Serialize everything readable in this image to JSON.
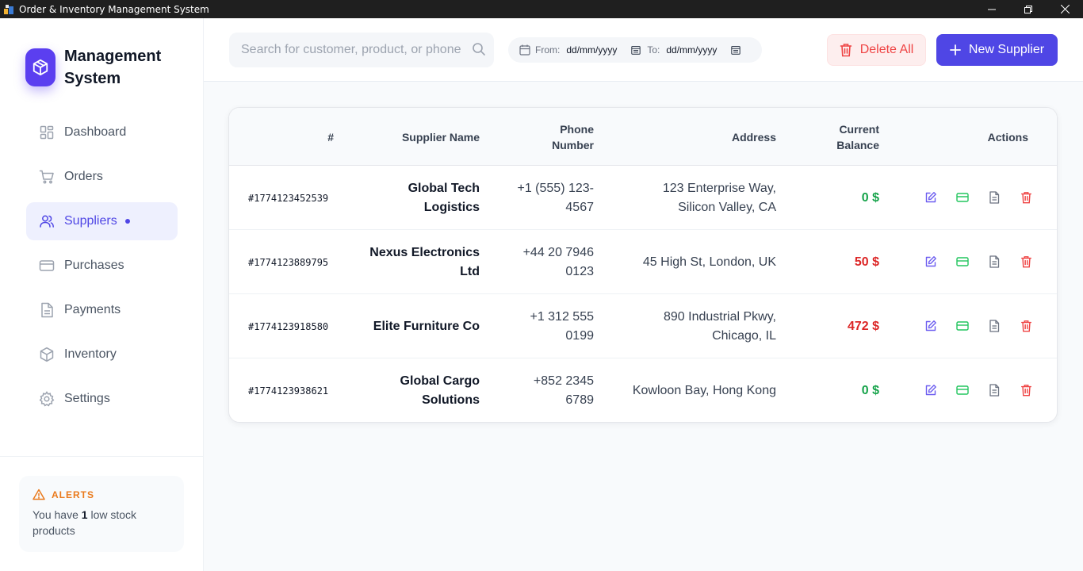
{
  "window": {
    "title": "Order & Inventory Management System"
  },
  "sidebar": {
    "brand": "Management System",
    "items": [
      {
        "label": "Dashboard",
        "icon": "dashboard-icon",
        "active": false
      },
      {
        "label": "Orders",
        "icon": "cart-icon",
        "active": false
      },
      {
        "label": "Suppliers",
        "icon": "users-icon",
        "active": true
      },
      {
        "label": "Purchases",
        "icon": "card-icon",
        "active": false
      },
      {
        "label": "Payments",
        "icon": "document-icon",
        "active": false
      },
      {
        "label": "Inventory",
        "icon": "box-icon",
        "active": false
      },
      {
        "label": "Settings",
        "icon": "gear-icon",
        "active": false
      }
    ],
    "alerts": {
      "title": "ALERTS",
      "text_before": "You have ",
      "count": "1",
      "text_after": " low stock products"
    }
  },
  "topbar": {
    "search_placeholder": "Search for customer, product, or phone",
    "from_label": "From:",
    "from_value": "dd/mm/yyyy",
    "to_label": "To:",
    "to_value": "dd/mm/yyyy",
    "delete_all_label": "Delete All",
    "new_supplier_label": "New Supplier"
  },
  "table": {
    "headers": {
      "id": "#",
      "name": "Supplier Name",
      "phone": "Phone Number",
      "address": "Address",
      "balance": "Current Balance",
      "actions": "Actions"
    },
    "rows": [
      {
        "id": "#1774123452539",
        "name": "Global Tech Logistics",
        "phone": "+1 (555) 123-4567",
        "address": "123 Enterprise Way, Silicon Valley, CA",
        "balance": "0 $",
        "balance_color": "#16a34a"
      },
      {
        "id": "#1774123889795",
        "name": "Nexus Electronics Ltd",
        "phone": "+44 20 7946 0123",
        "address": "45 High St, London, UK",
        "balance": "50 $",
        "balance_color": "#dc2626"
      },
      {
        "id": "#1774123918580",
        "name": "Elite Furniture Co",
        "phone": "+1 312 555 0199",
        "address": "890 Industrial Pkwy, Chicago, IL",
        "balance": "472 $",
        "balance_color": "#dc2626"
      },
      {
        "id": "#1774123938621",
        "name": "Global Cargo Solutions",
        "phone": "+852 2345 6789",
        "address": "Kowloon Bay, Hong Kong",
        "balance": "0 $",
        "balance_color": "#16a34a"
      }
    ]
  },
  "colors": {
    "accent": "#4f46e5",
    "danger": "#ef4444",
    "success": "#16a34a",
    "alert": "#ea7a1c"
  }
}
